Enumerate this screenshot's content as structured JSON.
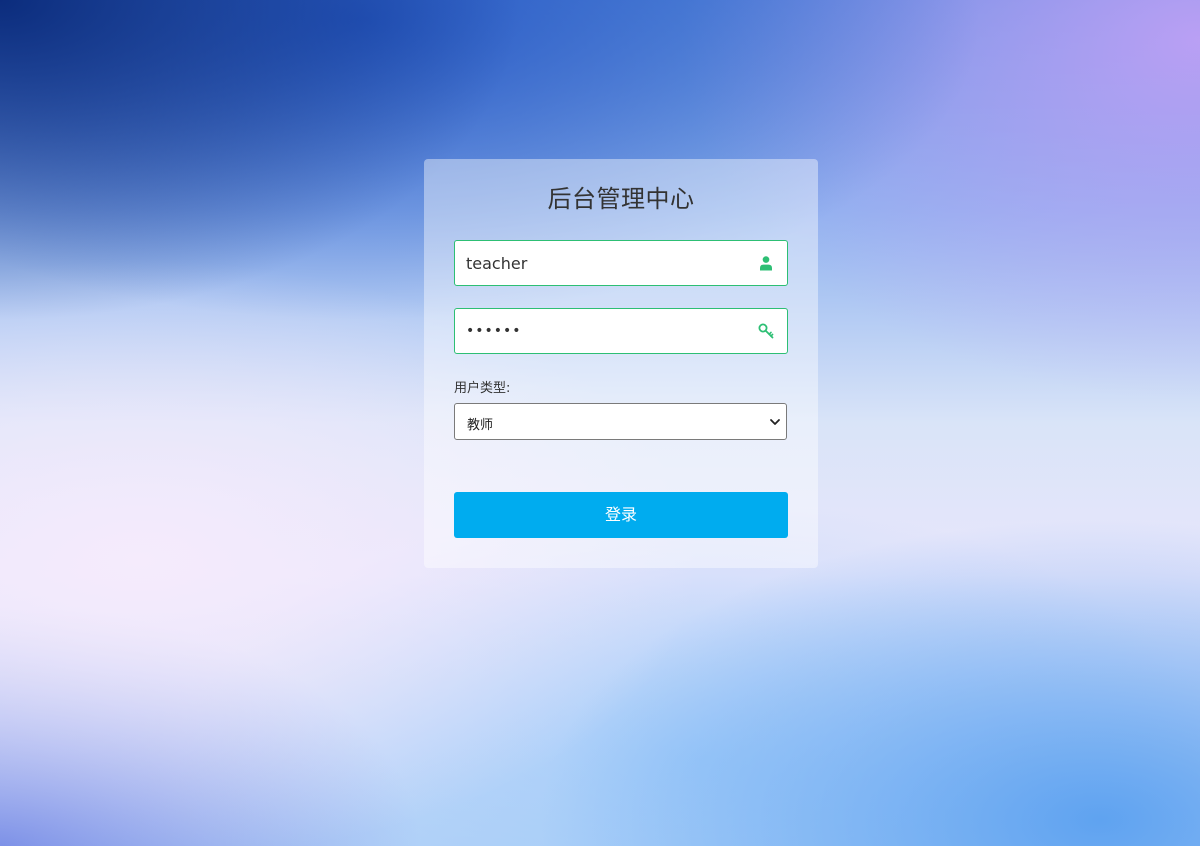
{
  "login": {
    "title": "后台管理中心",
    "username": {
      "value": "teacher",
      "icon": "user-icon"
    },
    "password": {
      "value": "••••••",
      "icon": "key-icon"
    },
    "user_type": {
      "label": "用户类型:",
      "selected": "教师",
      "icon": "chevron-down-icon"
    },
    "submit_label": "登录"
  },
  "colors": {
    "accent_green": "#2dbf74",
    "button_blue": "#00acef"
  }
}
